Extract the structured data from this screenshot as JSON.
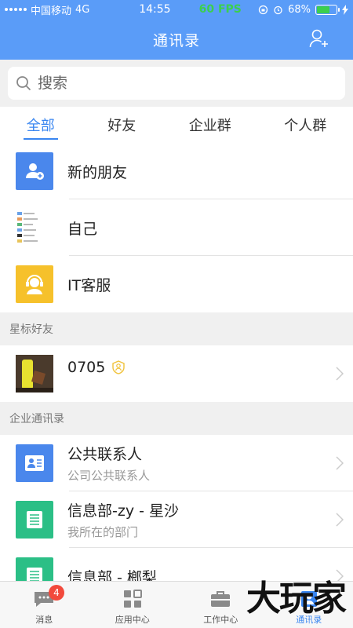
{
  "status_bar": {
    "carrier": "中国移动",
    "network": "4G",
    "time": "14:55",
    "fps": "60 FPS",
    "battery": "68%",
    "battery_level": 0.68
  },
  "nav": {
    "title": "通讯录",
    "right_icon": "add-contact-icon"
  },
  "search": {
    "placeholder": "搜索"
  },
  "tabs": [
    {
      "label": "全部",
      "active": true
    },
    {
      "label": "好友",
      "active": false
    },
    {
      "label": "企业群",
      "active": false
    },
    {
      "label": "个人群",
      "active": false
    }
  ],
  "quick_rows": [
    {
      "title": "新的朋友",
      "icon": "new-friend-icon",
      "color": "#4a87ec"
    },
    {
      "title": "自己",
      "icon": "self-thumbnail"
    },
    {
      "title": "IT客服",
      "icon": "customer-service-icon",
      "color": "#f6c12b"
    }
  ],
  "starred": {
    "header": "星标好友",
    "items": [
      {
        "name": "0705",
        "badge_icon": "verified-badge-icon",
        "avatar": "photo-avatar"
      }
    ]
  },
  "enterprise": {
    "header": "企业通讯录",
    "items": [
      {
        "title": "公共联系人",
        "subtitle": "公司公共联系人",
        "icon": "public-contacts-icon",
        "color": "#4a87ec"
      },
      {
        "title": "信息部-zy - 星沙",
        "subtitle": "我所在的部门",
        "icon": "department-icon",
        "color": "#2bbf86"
      },
      {
        "title": "信息部 - 榔梨",
        "subtitle": "",
        "icon": "department-icon",
        "color": "#2bbf86"
      }
    ]
  },
  "tabbar": {
    "items": [
      {
        "label": "消息",
        "icon": "message-icon",
        "badge": "4"
      },
      {
        "label": "应用中心",
        "icon": "app-grid-icon"
      },
      {
        "label": "工作中心",
        "icon": "briefcase-icon"
      },
      {
        "label": "通讯录",
        "icon": "contacts-icon",
        "active": true
      }
    ]
  },
  "watermark": "大玩家"
}
